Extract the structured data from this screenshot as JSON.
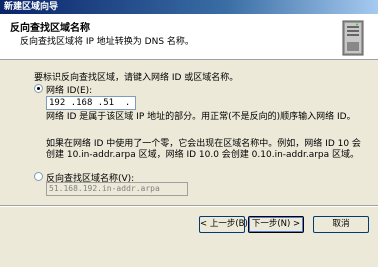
{
  "window": {
    "title": "新建区域向导"
  },
  "header": {
    "title": "反向查找区域名称",
    "subtitle": "反向查找区域将 IP 地址转换为 DNS 名称。"
  },
  "main": {
    "prompt": "要标识反向查找区域，请键入网络 ID 或区域名称。",
    "option_network_id": {
      "label": "网络 ID(E):",
      "checked": true
    },
    "ip_parts": [
      "192",
      ".168",
      ".51",
      "."
    ],
    "note1": "网络 ID 是属于该区域 IP 地址的部分。用正常(不是反向的)顺序输入网络 ID。",
    "note2": "如果在网络 ID 中使用了一个零，它会出现在区域名称中。例如，网络 ID 10 会创建 10.in-addr.arpa 区域，网络 ID 10.0 会创建 0.10.in-addr.arpa 区域。",
    "option_zone_name": {
      "label": "反向查找区域名称(V):",
      "checked": false
    },
    "zone_name_value": "51.168.192.in-addr.arpa"
  },
  "buttons": {
    "back": "< 上一步(B)",
    "next": "下一步(N) >",
    "cancel": "取消"
  }
}
